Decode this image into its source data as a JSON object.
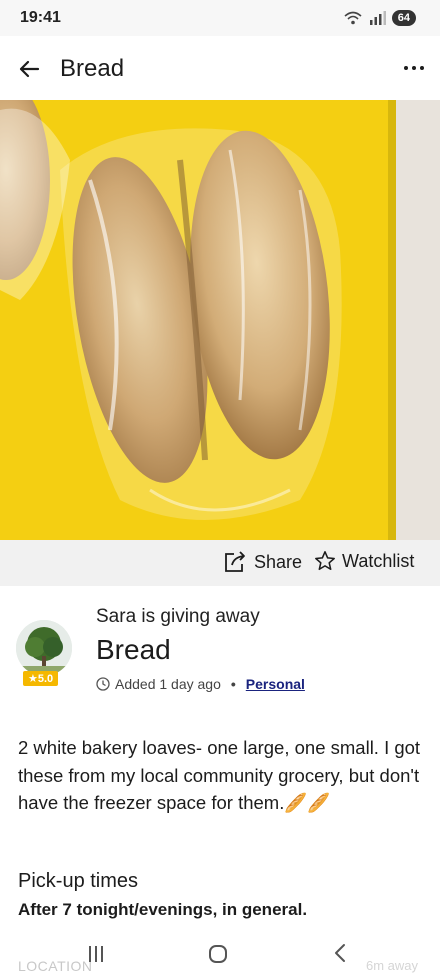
{
  "status": {
    "time": "19:41",
    "battery": "64"
  },
  "header": {
    "title": "Bread"
  },
  "actions": {
    "share": "Share",
    "watchlist": "Watchlist"
  },
  "listing": {
    "giver_line": "Sara is giving away",
    "title": "Bread",
    "rating": "5.0",
    "added": "Added 1 day ago",
    "category": "Personal",
    "description": "2 white bakery loaves- one large, one small. I got these from my local community grocery, but don't have the freezer space for them.🥖🥖",
    "pickup_title": "Pick-up times",
    "pickup_value": "After 7 tonight/evenings, in general."
  },
  "footer": {
    "location": "LOCATION",
    "away": "6m away"
  },
  "colors": {
    "photo_bg": "#f4cf12",
    "rating_bg": "#f5b800",
    "link": "#1a237e"
  },
  "icons": [
    "back-arrow-icon",
    "more-vert-icon",
    "share-icon",
    "star-outline-icon",
    "clock-icon",
    "wifi-icon",
    "signal-icon"
  ]
}
